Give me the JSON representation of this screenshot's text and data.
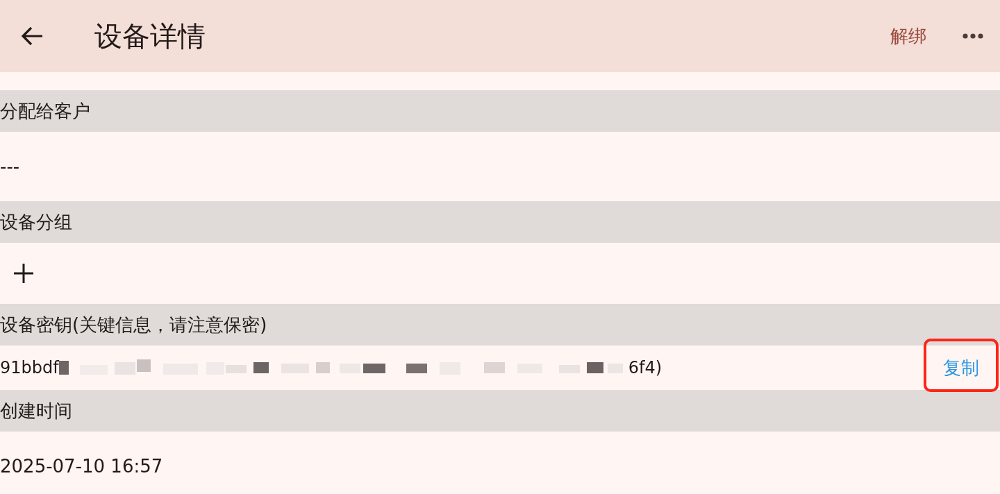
{
  "app_bar": {
    "title": "设备详情",
    "action": "解绑"
  },
  "sections": [
    {
      "kind": "text",
      "label": "分配给客户",
      "value": "---"
    },
    {
      "kind": "add",
      "label": "设备分组"
    },
    {
      "kind": "secret",
      "label": "设备密钥(关键信息，请注意保密)",
      "value_start": "91bbdf",
      "value_end": "6f4)",
      "action": "复制",
      "highlighted": true
    },
    {
      "kind": "text",
      "label": "创建时间",
      "value": "2025-07-10 16:57"
    }
  ]
}
